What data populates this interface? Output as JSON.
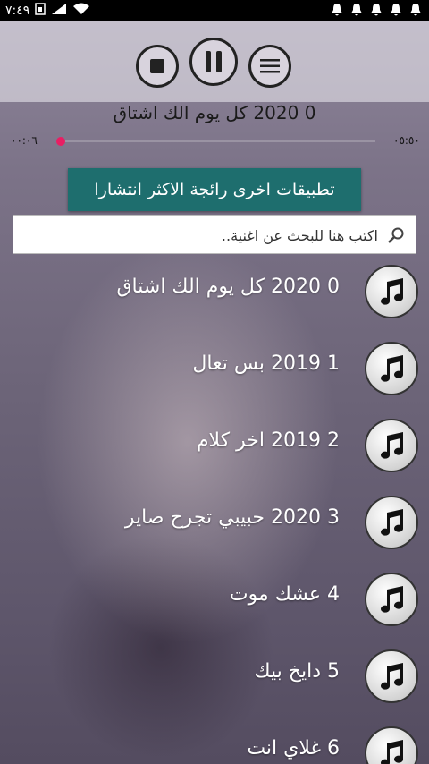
{
  "status_bar": {
    "time": "٧:٤٩",
    "icons": [
      "signal-icon",
      "wifi-icon",
      "notification-bell-icon"
    ]
  },
  "player": {
    "current_title": "0 2020 كل يوم الك اشتاق",
    "elapsed": "٠٠:٠٦",
    "duration": "٠٥:٥٠",
    "progress": 0.01,
    "buttons": [
      "stop",
      "pause",
      "menu"
    ]
  },
  "promo": {
    "label": "تطبيقات اخرى رائجة الاكثر انتشارا"
  },
  "search": {
    "placeholder": "اكتب هنا للبحث عن اغنية.."
  },
  "songs": [
    {
      "label": "0 2020 كل يوم الك اشتاق"
    },
    {
      "label": "1 2019 بس تعال"
    },
    {
      "label": "2 2019 اخر كلام"
    },
    {
      "label": "3 2020 حبيبي تجرح صاير"
    },
    {
      "label": "4 عشك موت"
    },
    {
      "label": "5 دايخ بيك"
    },
    {
      "label": "6 غلاي انت"
    }
  ],
  "colors": {
    "accent": "#e91e63",
    "promo_bg": "#1e6e6e"
  }
}
